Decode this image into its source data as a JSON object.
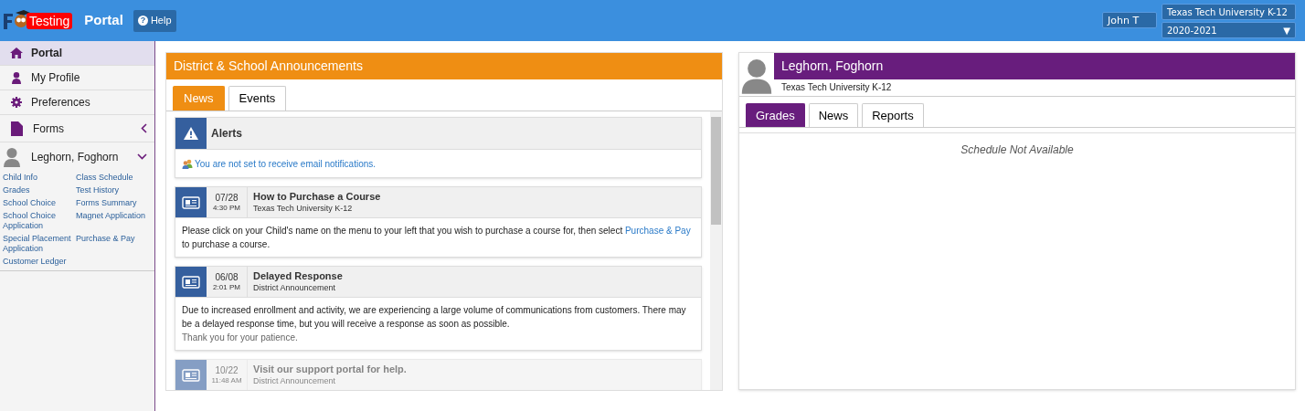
{
  "header": {
    "logo_badge": "Testing",
    "title": "Portal",
    "help": "Help",
    "help_glyph": "?",
    "user": "John T",
    "district": "Texas Tech University K-12",
    "year": "2020-2021",
    "year_arrow": "▼"
  },
  "sidebar": {
    "items": [
      {
        "label": "Portal",
        "selected": true
      },
      {
        "label": "My Profile",
        "selected": false
      },
      {
        "label": "Preferences",
        "selected": false
      },
      {
        "label": "Forms",
        "selected": false,
        "expanded": false
      }
    ],
    "student": {
      "name": "Leghorn, Foghorn",
      "expanded": true,
      "links": [
        "Child Info",
        "Class Schedule",
        "Grades",
        "Test History",
        "School Choice",
        "Forms Summary",
        "School Choice Application",
        "Magnet Application",
        "Special Placement Application",
        "Purchase & Pay",
        "Customer Ledger"
      ]
    }
  },
  "announcements": {
    "title": "District & School Announcements",
    "tabs": [
      {
        "label": "News",
        "selected": true
      },
      {
        "label": "Events",
        "selected": false
      }
    ],
    "alert": {
      "title": "Alerts",
      "message": "You are not set to receive email notifications."
    },
    "posts": [
      {
        "date": "07/28",
        "time": "4:30 PM",
        "title": "How to Purchase a Course",
        "source": "Texas Tech University K-12",
        "body": "Please click on your Child's name on the menu to your left that you wish to purchase a course for, then select",
        "link": "Purchase & Pay",
        "body_after": "to purchase a course.",
        "faded": false
      },
      {
        "date": "06/08",
        "time": "2:01 PM",
        "title": "Delayed Response",
        "source": "District Announcement",
        "body": "Due to increased enrollment and activity, we are experiencing a large volume of communications from customers. There may be a delayed response time, but you will receive a response as soon as possible.",
        "note": "Thank you for your patience.",
        "faded": false
      },
      {
        "date": "10/22",
        "time": "11:48 AM",
        "title": "Visit our support portal for help.",
        "source": "District Announcement",
        "faded": true
      }
    ]
  },
  "student_card": {
    "name": "Leghorn, Foghorn",
    "school": "Texas Tech University K-12",
    "tabs": [
      {
        "label": "Grades",
        "selected": true
      },
      {
        "label": "News",
        "selected": false
      },
      {
        "label": "Reports",
        "selected": false
      }
    ],
    "message": "Schedule Not Available"
  }
}
